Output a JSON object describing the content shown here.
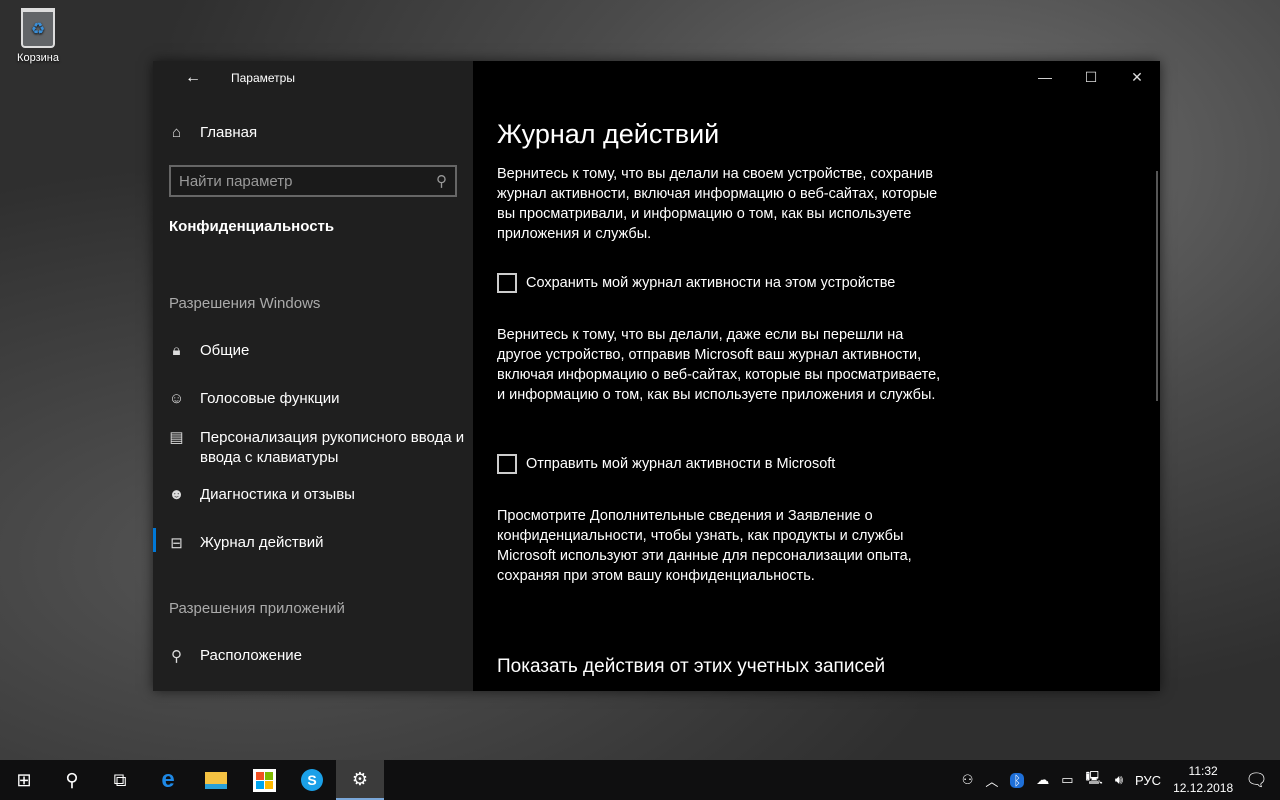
{
  "desktop": {
    "recycle_bin": "Корзина"
  },
  "window": {
    "title": "Параметры",
    "minimize": "—",
    "maximize": "☐",
    "close": "✕"
  },
  "sidebar": {
    "home": "Главная",
    "search_placeholder": "Найти параметр",
    "category": "Конфиденциальность",
    "section_windows": "Разрешения Windows",
    "items": [
      {
        "label": "Общие"
      },
      {
        "label": "Голосовые функции"
      },
      {
        "label": "Персонализация рукописного ввода и ввода с клавиатуры"
      },
      {
        "label": "Диагностика и отзывы"
      },
      {
        "label": "Журнал действий"
      }
    ],
    "section_apps": "Разрешения приложений",
    "app_items": [
      {
        "label": "Расположение"
      }
    ]
  },
  "main": {
    "title": "Журнал действий",
    "desc1": "Вернитесь к тому, что вы делали на своем устройстве, сохранив журнал активности, включая информацию о веб-сайтах, которые вы просматривали, и информацию о том, как вы используете приложения и службы.",
    "checkbox1": "Сохранить мой журнал активности на этом устройстве",
    "desc2": "Вернитесь к тому, что вы делали, даже если вы перешли на другое устройство, отправив Microsoft ваш журнал активности, включая информацию о веб-сайтах, которые вы просматриваете, и информацию о том, как вы используете приложения и службы.",
    "checkbox2": "Отправить мой журнал активности в Microsoft",
    "desc3": "Просмотрите Дополнительные сведения и Заявление о конфиденциальности, чтобы узнать, как продукты и службы Microsoft используют эти данные для персонализации опыта, сохраняя при этом вашу конфиденциальность.",
    "section2": "Показать действия от этих учетных записей"
  },
  "taskbar": {
    "language": "РУС",
    "time": "11:32",
    "date": "12.12.2018"
  }
}
